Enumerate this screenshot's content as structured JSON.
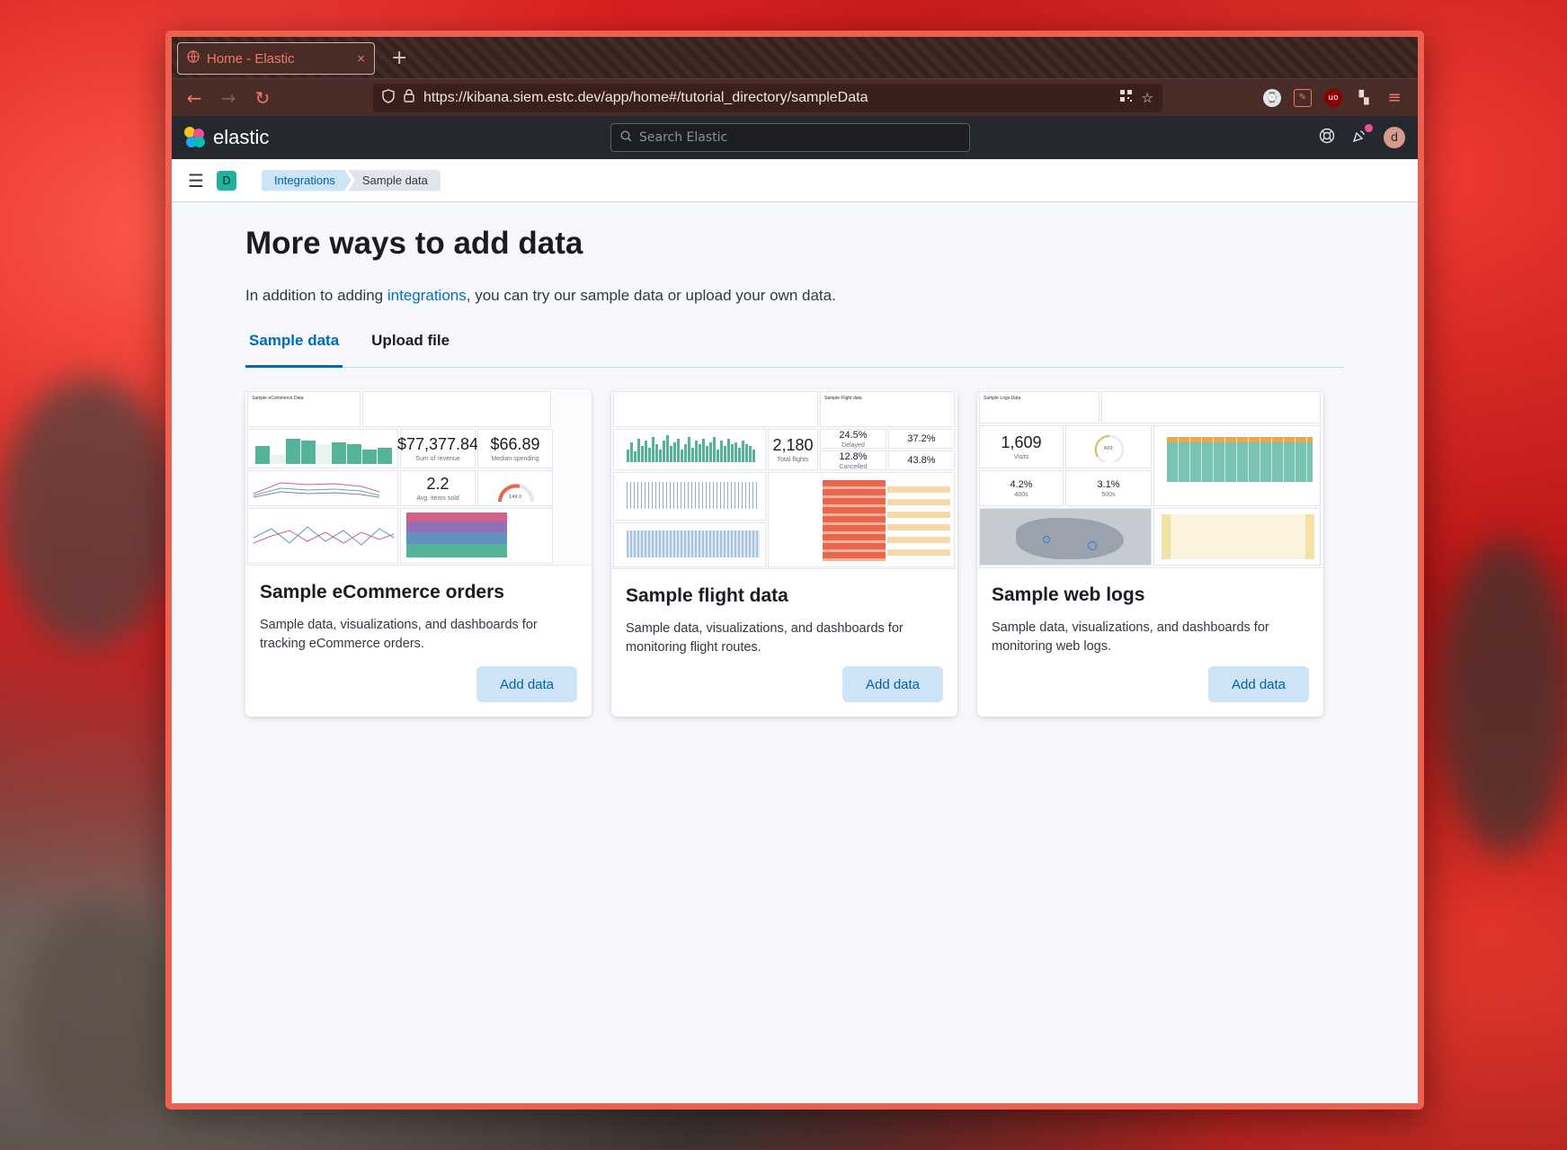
{
  "browser": {
    "tab_title": "Home - Elastic",
    "tab_close": "×",
    "new_tab": "+",
    "url": "https://kibana.siem.estc.dev/app/home#/tutorial_directory/sampleData"
  },
  "header": {
    "brand": "elastic",
    "search_placeholder": "Search Elastic",
    "avatar_initial": "d"
  },
  "breadcrumb": {
    "space_initial": "D",
    "items": [
      "Integrations",
      "Sample data"
    ]
  },
  "main": {
    "title": "More ways to add data",
    "intro_before": "In addition to adding ",
    "intro_link": "integrations",
    "intro_after": ", you can try our sample data or upload your own data.",
    "tabs": [
      {
        "label": "Sample data",
        "active": true
      },
      {
        "label": "Upload file",
        "active": false
      }
    ]
  },
  "cards": [
    {
      "title": "Sample eCommerce orders",
      "description": "Sample data, visualizations, and dashboards for tracking eCommerce orders.",
      "button": "Add data",
      "thumb": {
        "heading": "Sample eCommerce Data",
        "m1": "$77,377.84",
        "m1_label": "Sum of revenue",
        "m2": "$66.89",
        "m2_label": "Median spending",
        "m3": "2.2",
        "m3_label": "Avg. items sold",
        "gauge": "149.0"
      }
    },
    {
      "title": "Sample flight data",
      "description": "Sample data, visualizations, and dashboards for monitoring flight routes.",
      "button": "Add data",
      "thumb": {
        "heading": "Sample Flight data",
        "m1": "2,180",
        "m1_label": "Total flights",
        "p1": "24.5%",
        "p1_label": "Delayed",
        "p2": "37.2%",
        "p3": "12.8%",
        "p3_label": "Cancelled",
        "p4": "43.8%"
      }
    },
    {
      "title": "Sample web logs",
      "description": "Sample data, visualizations, and dashboards for monitoring web logs.",
      "button": "Add data",
      "thumb": {
        "heading": "Sample Logs Data",
        "m1": "1,609",
        "m1_label": "Visits",
        "gauge": "600",
        "p1": "4.2%",
        "p1_label": "400s",
        "p2": "3.1%",
        "p2_label": "500s"
      }
    }
  ],
  "colors": {
    "accent": "#006bb8",
    "button_bg": "#cce4f5",
    "header_bg": "#25282f",
    "window_border": "#f06050"
  }
}
